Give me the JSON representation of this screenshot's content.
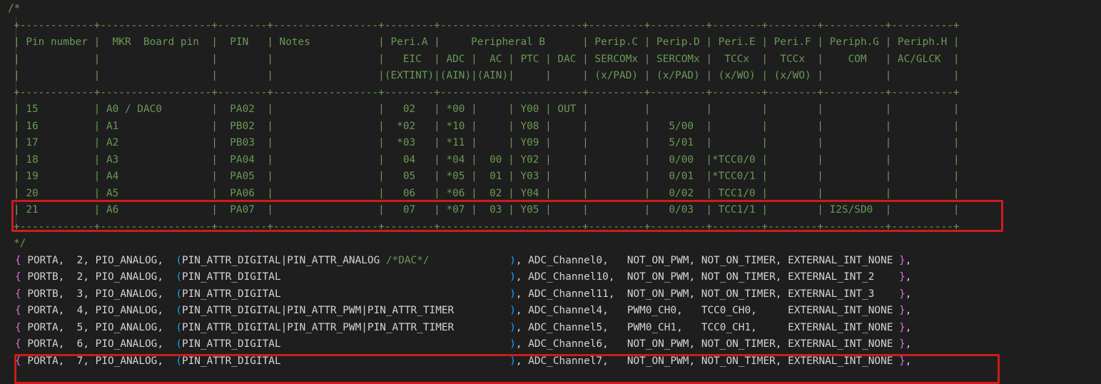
{
  "editor": {
    "comment_open": "/*",
    "comment_close": "*/",
    "table_lines": [
      "+------------+------------------+--------+-----------------+--------+-----------------------+---------+---------+--------+--------+----------+----------+",
      "| Pin number |  MKR  Board pin  |  PIN   | Notes           | Peri.A |     Peripheral B      | Perip.C | Perip.D | Peri.E | Peri.F | Periph.G | Periph.H |",
      "|            |                  |        |                 |   EIC  | ADC |  AC | PTC | DAC | SERCOMx | SERCOMx |  TCCx  |  TCCx  |    COM   | AC/GLCK  |",
      "|            |                  |        |                 |(EXTINT)|(AIN)|(AIN)|     |     | (x/PAD) | (x/PAD) | (x/WO) | (x/WO) |          |          |",
      "+------------+------------------+--------+-----------------+--------+-----------------------+---------+---------+--------+--------+----------+----------+",
      "| 15         | A0 / DAC0        |  PA02  |                 |   02   | *00 |     | Y00 | OUT |         |         |        |        |          |          |",
      "| 16         | A1               |  PB02  |                 |  *02   | *10 |     | Y08 |     |         |   5/00  |        |        |          |          |",
      "| 17         | A2               |  PB03  |                 |  *03   | *11 |     | Y09 |     |         |   5/01  |        |        |          |          |",
      "| 18         | A3               |  PA04  |                 |   04   | *04 |  00 | Y02 |     |         |   0/00  |*TCC0/0 |        |          |          |",
      "| 19         | A4               |  PA05  |                 |   05   | *05 |  01 | Y03 |     |         |   0/01  |*TCC0/1 |        |          |          |",
      "| 20         | A5               |  PA06  |                 |   06   | *06 |  02 | Y04 |     |         |   0/02  | TCC1/0 |        |          |          |",
      "| 21         | A6               |  PA07  |                 |   07   | *07 |  03 | Y05 |     |         |   0/03  | TCC1/1 |        | I2S/SD0  |          |",
      "+------------+------------------+--------+-----------------+--------+-----------------------+---------+---------+--------+--------+----------+----------+"
    ],
    "code_rows": [
      {
        "port": "PORTA",
        "pin": "2",
        "type": "PIO_ANALOG",
        "attrs": "PIN_ATTR_DIGITAL|PIN_ATTR_ANALOG",
        "attr_comment": "/*DAC*/",
        "adc": "ADC_Channel0,",
        "pwm": "NOT_ON_PWM,",
        "timer": "NOT_ON_TIMER,",
        "ext": "EXTERNAL_INT_NONE"
      },
      {
        "port": "PORTB",
        "pin": "2",
        "type": "PIO_ANALOG",
        "attrs": "PIN_ATTR_DIGITAL",
        "attr_comment": "",
        "adc": "ADC_Channel10,",
        "pwm": "NOT_ON_PWM,",
        "timer": "NOT_ON_TIMER,",
        "ext": "EXTERNAL_INT_2"
      },
      {
        "port": "PORTB",
        "pin": "3",
        "type": "PIO_ANALOG",
        "attrs": "PIN_ATTR_DIGITAL",
        "attr_comment": "",
        "adc": "ADC_Channel11,",
        "pwm": "NOT_ON_PWM,",
        "timer": "NOT_ON_TIMER,",
        "ext": "EXTERNAL_INT_3"
      },
      {
        "port": "PORTA",
        "pin": "4",
        "type": "PIO_ANALOG",
        "attrs": "PIN_ATTR_DIGITAL|PIN_ATTR_PWM|PIN_ATTR_TIMER",
        "attr_comment": "",
        "adc": "ADC_Channel4,",
        "pwm": "PWM0_CH0,",
        "timer": "TCC0_CH0,",
        "ext": "EXTERNAL_INT_NONE"
      },
      {
        "port": "PORTA",
        "pin": "5",
        "type": "PIO_ANALOG",
        "attrs": "PIN_ATTR_DIGITAL|PIN_ATTR_PWM|PIN_ATTR_TIMER",
        "attr_comment": "",
        "adc": "ADC_Channel5,",
        "pwm": "PWM0_CH1,",
        "timer": "TCC0_CH1,",
        "ext": "EXTERNAL_INT_NONE"
      },
      {
        "port": "PORTA",
        "pin": "6",
        "type": "PIO_ANALOG",
        "attrs": "PIN_ATTR_DIGITAL",
        "attr_comment": "",
        "adc": "ADC_Channel6,",
        "pwm": "NOT_ON_PWM,",
        "timer": "NOT_ON_TIMER,",
        "ext": "EXTERNAL_INT_NONE"
      },
      {
        "port": "PORTA",
        "pin": "7",
        "type": "PIO_ANALOG",
        "attrs": "PIN_ATTR_DIGITAL",
        "attr_comment": "",
        "adc": "ADC_Channel7,",
        "pwm": "NOT_ON_PWM,",
        "timer": "NOT_ON_TIMER,",
        "ext": "EXTERNAL_INT_NONE"
      }
    ],
    "highlights": [
      "table-row-21",
      "code-row-porta-7"
    ],
    "colors": {
      "background": "#1e1e1e",
      "comment": "#6a9955",
      "text": "#d4d4d4",
      "brace": "#da70d6",
      "paren": "#179fff",
      "highlight_box": "#d11a1a"
    }
  }
}
